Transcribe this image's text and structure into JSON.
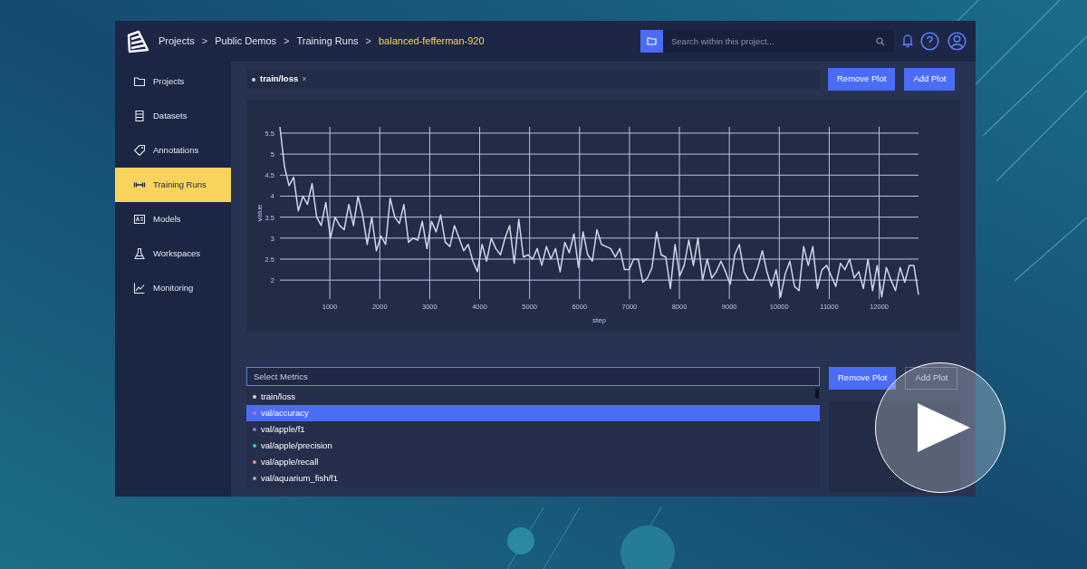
{
  "breadcrumbs": [
    {
      "label": "Projects",
      "current": false
    },
    {
      "label": "Public Demos",
      "current": false
    },
    {
      "label": "Training Runs",
      "current": false
    },
    {
      "label": "balanced-fefferman-920",
      "current": true
    }
  ],
  "separator": ">",
  "search": {
    "placeholder": "Search within this project..."
  },
  "sidebar": {
    "items": [
      {
        "label": "Projects",
        "selected": false
      },
      {
        "label": "Datasets",
        "selected": false
      },
      {
        "label": "Annotations",
        "selected": false
      },
      {
        "label": "Training Runs",
        "selected": true
      },
      {
        "label": "Models",
        "selected": false
      },
      {
        "label": "Workspaces",
        "selected": false
      },
      {
        "label": "Monitoring",
        "selected": false
      }
    ]
  },
  "plots": [
    {
      "close": "×",
      "buttons": [
        {
          "label": "Remove Plot",
          "disabled": false
        },
        {
          "label": "Add Plot",
          "disabled": false
        }
      ],
      "chart_data": {
        "type": "line",
        "xlabel": "step",
        "ylabel": "value",
        "grid": true,
        "xlim": [
          0,
          12788
        ],
        "ylim": [
          1.55,
          5.65
        ],
        "xticks": [
          1000,
          2000,
          3000,
          4000,
          5000,
          6000,
          7000,
          8000,
          9000,
          10000,
          11000,
          12000
        ],
        "yticks": [
          2,
          2.5,
          3,
          3.5,
          4,
          4.5,
          5,
          5.5
        ],
        "x": [
          0,
          92,
          184,
          276,
          368,
          460,
          552,
          644,
          736,
          828,
          920,
          1012,
          1104,
          1196,
          1288,
          1380,
          1472,
          1564,
          1656,
          1748,
          1840,
          1932,
          2024,
          2116,
          2208,
          2300,
          2392,
          2484,
          2576,
          2668,
          2760,
          2852,
          2944,
          3036,
          3128,
          3220,
          3312,
          3404,
          3496,
          3588,
          3680,
          3772,
          3864,
          3956,
          4048,
          4140,
          4232,
          4324,
          4416,
          4508,
          4600,
          4692,
          4784,
          4876,
          4968,
          5060,
          5152,
          5244,
          5336,
          5428,
          5520,
          5612,
          5704,
          5796,
          5888,
          5980,
          6072,
          6164,
          6256,
          6348,
          6440,
          6532,
          6624,
          6716,
          6808,
          6900,
          6992,
          7084,
          7176,
          7268,
          7360,
          7452,
          7544,
          7636,
          7728,
          7820,
          7912,
          8004,
          8096,
          8188,
          8280,
          8372,
          8464,
          8556,
          8648,
          8740,
          8832,
          8924,
          9016,
          9108,
          9200,
          9292,
          9384,
          9476,
          9568,
          9660,
          9752,
          9844,
          9936,
          10028,
          10120,
          10212,
          10304,
          10396,
          10488,
          10580,
          10672,
          10764,
          10856,
          10948,
          11040,
          11132,
          11224,
          11316,
          11408,
          11500,
          11592,
          11684,
          11776,
          11868,
          11960,
          12052,
          12144,
          12236,
          12328,
          12420,
          12512,
          12604,
          12696,
          12788
        ],
        "series": [
          {
            "name": "train/loss",
            "color": "#d0d6e8",
            "values": [
              5.65,
              4.7,
              4.25,
              4.45,
              3.65,
              4.0,
              3.8,
              4.3,
              3.5,
              3.3,
              3.85,
              3.0,
              3.5,
              3.3,
              3.2,
              3.8,
              3.3,
              4.0,
              3.55,
              2.85,
              3.5,
              2.7,
              3.05,
              2.85,
              3.95,
              3.5,
              3.35,
              3.8,
              2.9,
              3.0,
              2.95,
              3.4,
              2.75,
              3.4,
              3.15,
              3.55,
              2.9,
              2.8,
              3.3,
              3.0,
              2.7,
              2.85,
              2.45,
              2.2,
              2.85,
              2.45,
              3.0,
              2.75,
              2.6,
              3.0,
              3.3,
              2.4,
              3.45,
              2.55,
              2.6,
              2.5,
              2.75,
              2.35,
              2.8,
              2.5,
              2.75,
              2.2,
              2.9,
              2.65,
              3.1,
              2.3,
              3.15,
              2.6,
              2.45,
              3.2,
              2.85,
              2.8,
              2.75,
              2.55,
              2.75,
              2.25,
              2.25,
              2.5,
              2.5,
              1.95,
              2.05,
              2.3,
              3.15,
              2.6,
              2.55,
              1.8,
              2.85,
              2.1,
              2.35,
              2.95,
              2.35,
              3.0,
              2.0,
              2.5,
              2.05,
              2.2,
              2.45,
              2.2,
              1.9,
              2.6,
              2.85,
              2.2,
              2.0,
              2.0,
              2.3,
              2.7,
              2.2,
              1.85,
              2.25,
              1.6,
              2.15,
              2.45,
              1.85,
              1.75,
              2.8,
              2.35,
              2.8,
              1.8,
              2.25,
              2.35,
              2.1,
              1.85,
              2.4,
              2.25,
              2.5,
              2.05,
              2.2,
              1.8,
              2.5,
              1.75,
              2.35,
              1.6,
              2.3,
              2.0,
              1.75,
              2.3,
              1.95,
              2.35,
              2.35,
              1.65
            ]
          }
        ]
      }
    },
    {
      "metric_select": {
        "placeholder": "Select Metrics",
        "options": [
          {
            "label": "train/loss",
            "color": "#d0d6e8",
            "selected": false
          },
          {
            "label": "val/accuracy",
            "color": "#e060d0",
            "selected": true
          },
          {
            "label": "val/apple/f1",
            "color": "#8a7ee0",
            "selected": false
          },
          {
            "label": "val/apple/precision",
            "color": "#3cc9b0",
            "selected": false
          },
          {
            "label": "val/apple/recall",
            "color": "#e09080",
            "selected": false
          },
          {
            "label": "val/aquarium_fish/f1",
            "color": "#a0a8c0",
            "selected": false
          }
        ]
      },
      "buttons": [
        {
          "label": "Remove Plot",
          "disabled": false
        },
        {
          "label": "Add Plot",
          "disabled": true
        }
      ]
    }
  ]
}
